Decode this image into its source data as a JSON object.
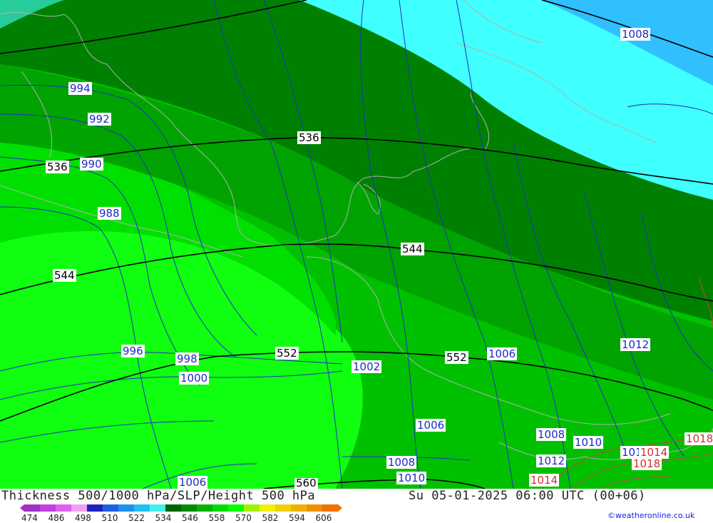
{
  "footer": {
    "title": "Thickness 500/1000 hPa/SLP/Height 500 hPa",
    "datetime": "Su 05-01-2025 06:00 UTC (00+06)",
    "credit": "©weatheronline.co.uk"
  },
  "legend": {
    "values": [
      "474",
      "486",
      "498",
      "510",
      "522",
      "534",
      "546",
      "558",
      "570",
      "582",
      "594",
      "606"
    ],
    "colors": [
      "#a030c0",
      "#c040e0",
      "#e060f0",
      "#f0a0f0",
      "#2020c0",
      "#2060e0",
      "#2090f0",
      "#20c0f0",
      "#40f0f0",
      "#006400",
      "#008c00",
      "#00b400",
      "#00dc00",
      "#00ff00",
      "#a0f000",
      "#f0f000",
      "#f0d000",
      "#f0b000",
      "#f09000",
      "#f07000"
    ]
  },
  "map": {
    "thickness_labels": [
      "536",
      "536",
      "544",
      "544",
      "552",
      "552",
      "560"
    ],
    "pressure_labels": [
      "994",
      "992",
      "990",
      "988",
      "996",
      "998",
      "1000",
      "1002",
      "1006",
      "1006",
      "1008",
      "1008",
      "1008",
      "1010",
      "1010",
      "1012",
      "1012",
      "1006",
      "1014",
      "1014",
      "1018",
      "1018",
      "1010"
    ],
    "colors": {
      "cyan": "#40ffff",
      "sky": "#30c0ff",
      "dark_green": "#008000",
      "green_2": "#00a000",
      "green_3": "#00c000",
      "green_4": "#00e000",
      "light_green": "#10ff10",
      "isobar": "#2030c0",
      "thickness_line": "#000000",
      "coast": "#b0b0b0"
    }
  }
}
